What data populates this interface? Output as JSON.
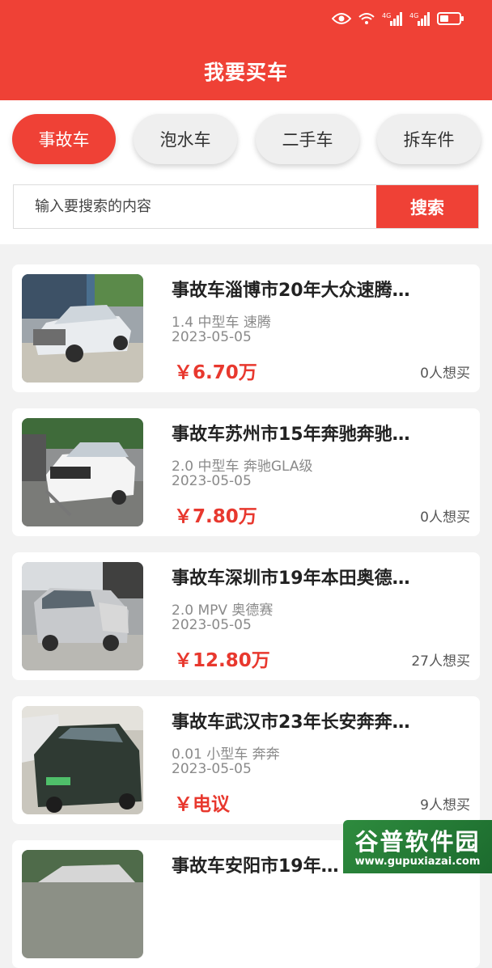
{
  "status_bar": {
    "icons": [
      "eye-icon",
      "wifi-icon",
      "signal-icon",
      "signal-icon",
      "battery-icon"
    ],
    "signal_tags": [
      "4G",
      "4G"
    ]
  },
  "header": {
    "title": "我要买车"
  },
  "categories": [
    {
      "label": "事故车",
      "active": true
    },
    {
      "label": "泡水车",
      "active": false
    },
    {
      "label": "二手车",
      "active": false
    },
    {
      "label": "拆车件",
      "active": false
    }
  ],
  "search": {
    "placeholder": "输入要搜索的内容",
    "button_label": "搜索"
  },
  "listings": [
    {
      "title": "事故车淄博市20年大众速腾…",
      "spec": "1.4 中型车 速腾",
      "date": "2023-05-05",
      "price": "￥6.70万",
      "want": "0人想买"
    },
    {
      "title": "事故车苏州市15年奔驰奔驰…",
      "spec": "2.0 中型车 奔驰GLA级",
      "date": "2023-05-05",
      "price": "￥7.80万",
      "want": "0人想买"
    },
    {
      "title": "事故车深圳市19年本田奥德…",
      "spec": "2.0 MPV 奥德赛",
      "date": "2023-05-05",
      "price": "￥12.80万",
      "want": "27人想买"
    },
    {
      "title": "事故车武汉市23年长安奔奔…",
      "spec": "0.01 小型车 奔奔",
      "date": "2023-05-05",
      "price": "￥电议",
      "want": "9人想买"
    },
    {
      "title": "事故车安阳市19年…",
      "spec": "",
      "date": "",
      "price": "",
      "want": ""
    }
  ],
  "watermark": {
    "logo": "谷普软件园",
    "url": "www.gupuxiazai.com"
  },
  "colors": {
    "accent": "#ef4136",
    "price": "#e8382e",
    "background": "#f2f2f2"
  }
}
